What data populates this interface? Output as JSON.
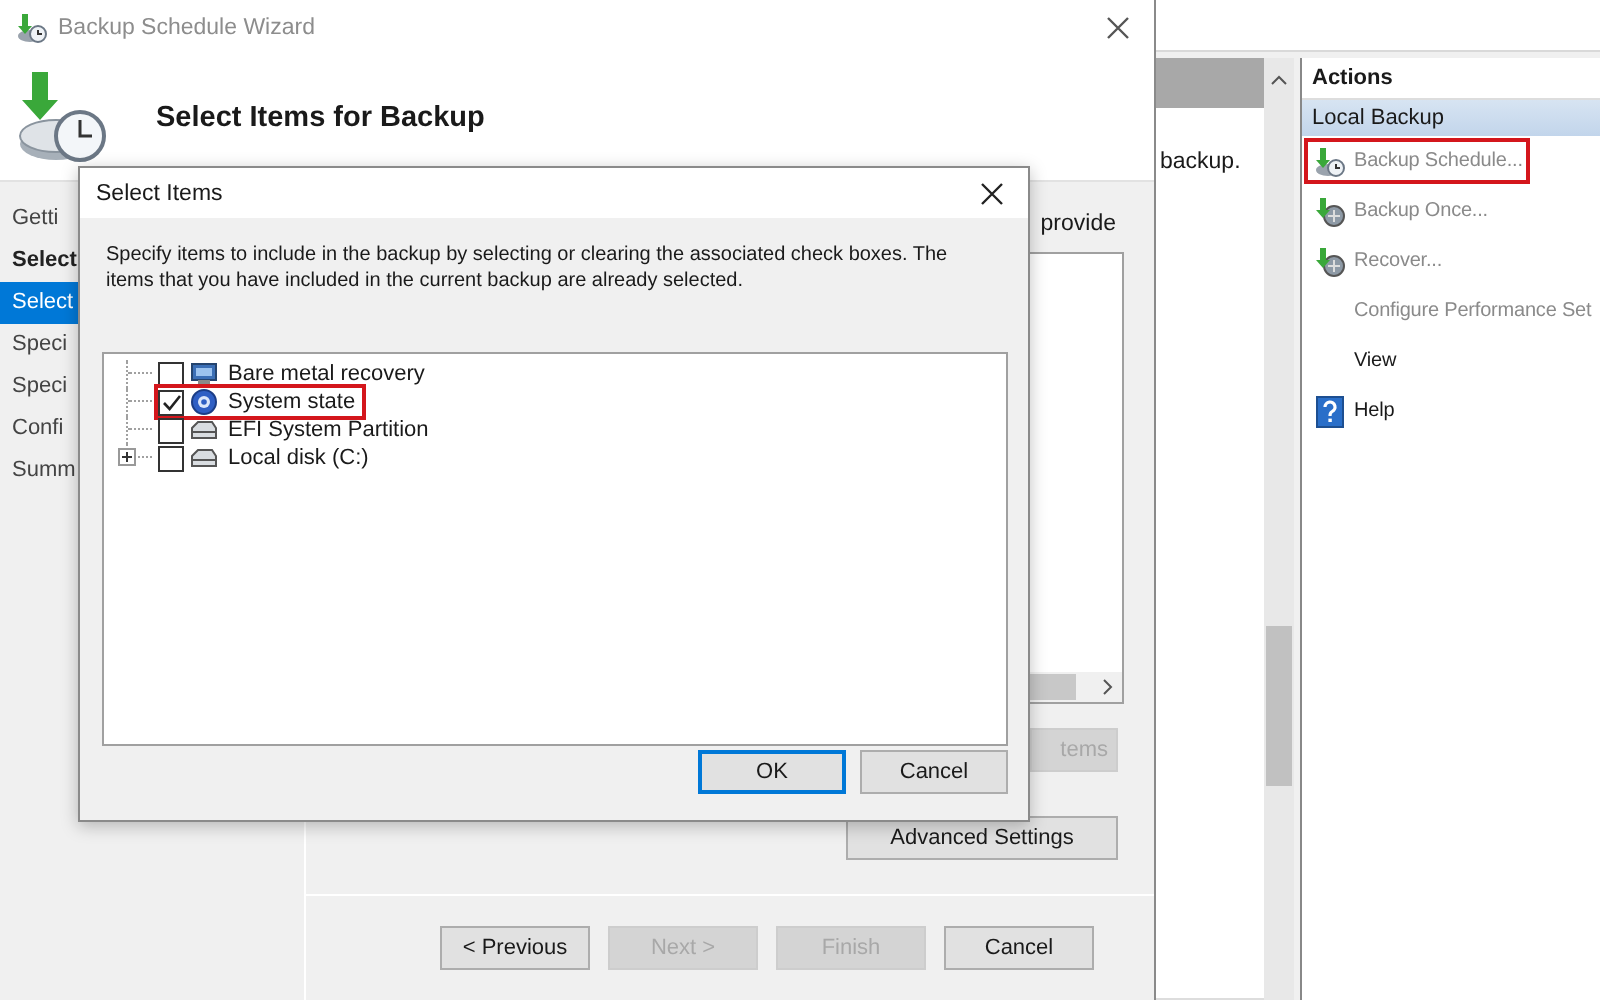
{
  "console": {
    "partial_text": "backup.",
    "actions": {
      "title": "Actions",
      "group": "Local Backup",
      "items": [
        {
          "label": "Backup Schedule...",
          "kind": "schedule",
          "disabled": true,
          "highlighted": true
        },
        {
          "label": "Backup Once...",
          "kind": "backup",
          "disabled": true,
          "highlighted": false
        },
        {
          "label": "Recover...",
          "kind": "backup",
          "disabled": true,
          "highlighted": false
        },
        {
          "label": "Configure Performance Set",
          "kind": "plain",
          "disabled": true,
          "highlighted": false
        },
        {
          "label": "View",
          "kind": "plain",
          "disabled": false,
          "highlighted": false
        },
        {
          "label": "Help",
          "kind": "help",
          "disabled": false,
          "highlighted": false
        }
      ]
    }
  },
  "wizard": {
    "title": "Backup Schedule Wizard",
    "heading": "Select Items for Backup",
    "steps": [
      {
        "label": "Getti",
        "selected": false
      },
      {
        "label": "Select",
        "selected": false
      },
      {
        "label": "Select",
        "selected": true
      },
      {
        "label": "Speci",
        "selected": false
      },
      {
        "label": "Speci",
        "selected": false
      },
      {
        "label": "Confi",
        "selected": false
      },
      {
        "label": "Summ",
        "selected": false
      }
    ],
    "partial_text": "provide",
    "side_buttons": [
      {
        "label": "tems",
        "disabled": true
      },
      {
        "label": "Advanced Settings",
        "disabled": false
      }
    ],
    "nav_buttons": [
      {
        "label": "< Previous",
        "disabled": false
      },
      {
        "label": "Next >",
        "disabled": true
      },
      {
        "label": "Finish",
        "disabled": true
      },
      {
        "label": "Cancel",
        "disabled": false
      }
    ]
  },
  "dialog": {
    "title": "Select Items",
    "description": "Specify items to include in the backup by selecting or clearing the associated check boxes. The items that you have included in the current backup are already selected.",
    "tree": [
      {
        "label": "Bare metal recovery",
        "kind": "computer",
        "checked": false,
        "highlighted": false,
        "expandable": false
      },
      {
        "label": "System state",
        "kind": "system",
        "checked": true,
        "highlighted": true,
        "expandable": false
      },
      {
        "label": "EFI System Partition",
        "kind": "drive",
        "checked": false,
        "highlighted": false,
        "expandable": false
      },
      {
        "label": "Local disk (C:)",
        "kind": "drive",
        "checked": false,
        "highlighted": false,
        "expandable": true
      }
    ],
    "buttons": [
      {
        "label": "OK",
        "default": true
      },
      {
        "label": "Cancel",
        "default": false
      }
    ]
  }
}
